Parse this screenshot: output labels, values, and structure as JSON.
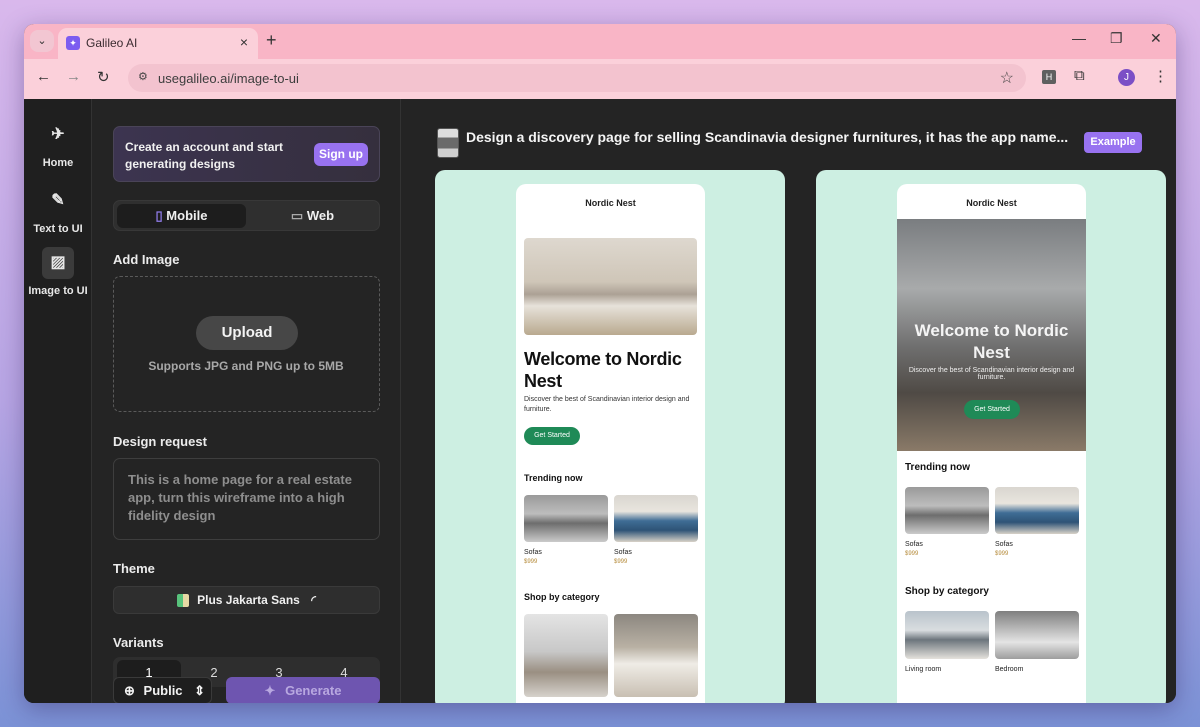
{
  "browser": {
    "tab_title": "Galileo AI",
    "url": "usegalileo.ai/image-to-ui",
    "profile_initial": "J",
    "extension_label": "H"
  },
  "rail": {
    "items": [
      {
        "label": "Home",
        "icon": "rocket-icon"
      },
      {
        "label": "Text to UI",
        "icon": "edit-icon"
      },
      {
        "label": "Image to UI",
        "icon": "image-icon"
      }
    ]
  },
  "panel": {
    "signup_text": "Create an account and start generating designs",
    "signup_button": "Sign up",
    "mode_mobile": "Mobile",
    "mode_web": "Web",
    "add_image_label": "Add Image",
    "upload_button": "Upload",
    "upload_hint": "Supports JPG and PNG up to 5MB",
    "design_request_label": "Design request",
    "design_request_placeholder": "This is a home page for a real estate app, turn this wireframe into a high fidelity design",
    "theme_label": "Theme",
    "theme_value": "Plus Jakarta Sans",
    "variants_label": "Variants",
    "variants": [
      "1",
      "2",
      "3",
      "4"
    ],
    "visibility": "Public",
    "generate_button": "Generate"
  },
  "main": {
    "prompt": "Design a discovery page for selling Scandinavia designer furnitures, it has the app name...",
    "example_badge": "Example",
    "design1": {
      "brand": "Nordic Nest",
      "headline": "Welcome to Nordic Nest",
      "subtitle": "Discover the best of Scandinavian interior design and furniture.",
      "cta": "Get Started",
      "trending_title": "Trending now",
      "items": [
        {
          "name": "Sofas",
          "price": "$999"
        },
        {
          "name": "Sofas",
          "price": "$999"
        }
      ],
      "category_title": "Shop by category"
    },
    "design2": {
      "brand": "Nordic Nest",
      "headline": "Welcome to Nordic Nest",
      "subtitle": "Discover the best of Scandinavian interior design and furniture.",
      "cta": "Get Started",
      "trending_title": "Trending now",
      "items": [
        {
          "name": "Sofas",
          "price": "$999"
        },
        {
          "name": "Sofas",
          "price": "$999"
        }
      ],
      "category_title": "Shop by category",
      "categories": [
        "Living room",
        "Bedroom"
      ]
    }
  },
  "colors": {
    "accent": "#9872f0",
    "card_bg": "#cdefe2",
    "cta_green": "#1f8a57",
    "tabstrip": "#f9b5c6"
  }
}
